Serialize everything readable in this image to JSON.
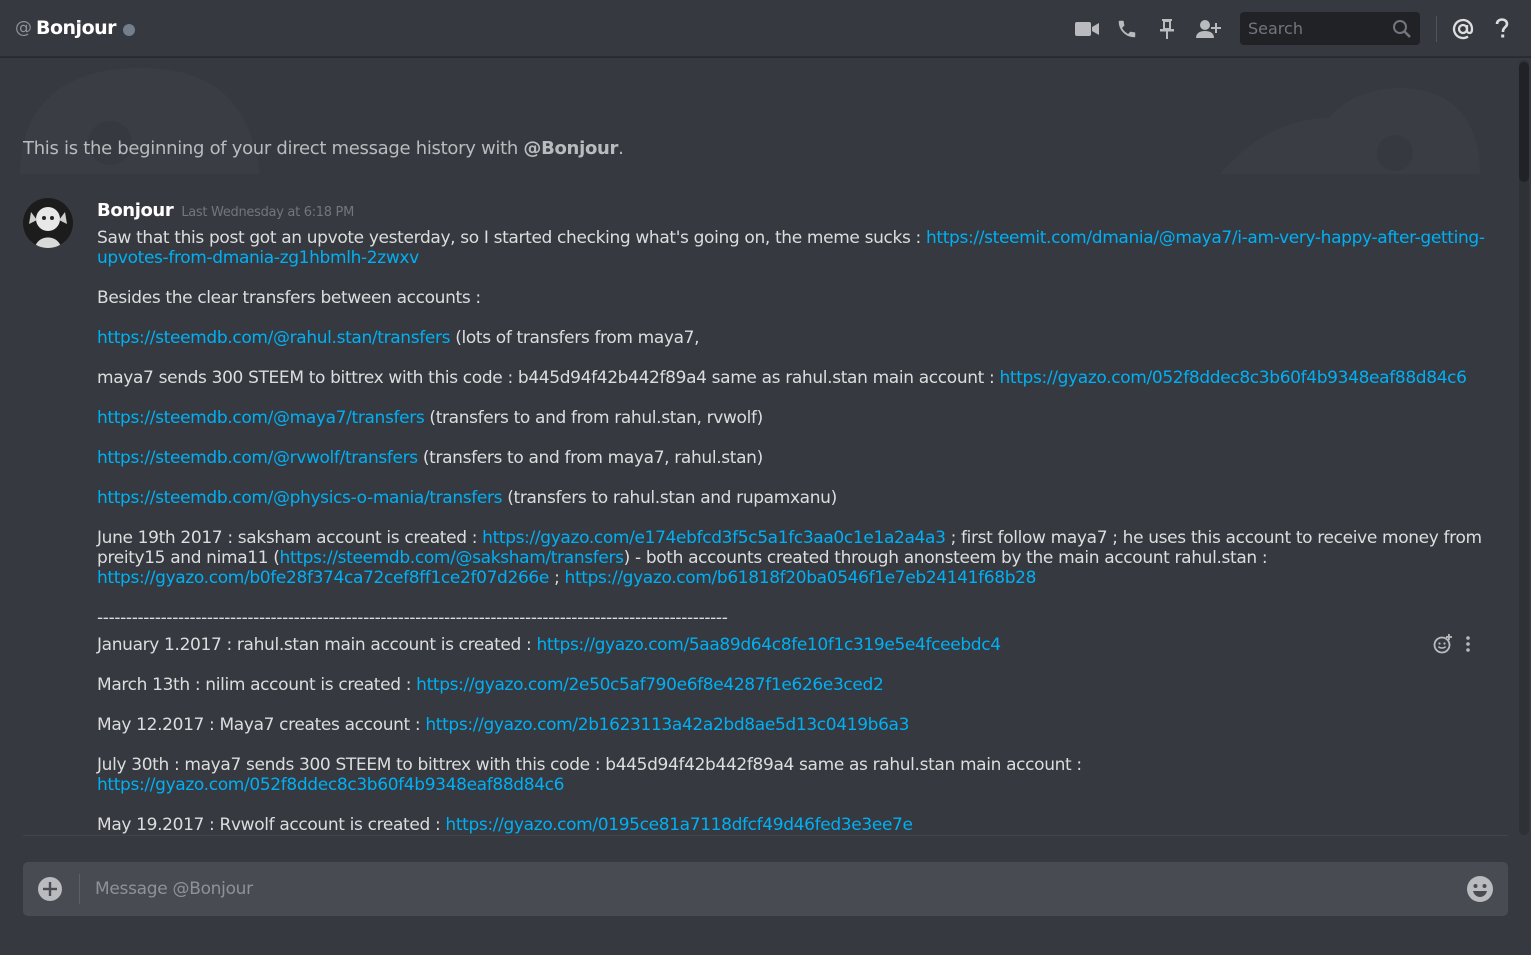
{
  "header": {
    "at_symbol": "@",
    "title": "Bonjour",
    "search_placeholder": "Search",
    "icons": [
      "video-call-icon",
      "phone-call-icon",
      "pin-icon",
      "add-friend-icon",
      "search-icon",
      "mention-icon",
      "help-icon"
    ]
  },
  "welcome": {
    "prefix": "This is the beginning of your direct message history with ",
    "handle": "@Bonjour",
    "suffix": "."
  },
  "message": {
    "author": "Bonjour",
    "timestamp": "Last Wednesday at 6:18 PM",
    "p1_text": "Saw that this post got an upvote yesterday, so I started checking what's going on, the meme sucks : ",
    "p1_link": "https://steemit.com/dmania/@maya7/i-am-very-happy-after-getting-upvotes-from-dmania-zg1hbmlh-2zwxv",
    "p2_text": "Besides the clear transfers between accounts :",
    "p3_link": "https://steemdb.com/@rahul.stan/transfers",
    "p3_text": " (lots of transfers from maya7,",
    "p4_text": "maya7 sends 300 STEEM to bittrex with this code : b445d94f42b442f89a4 same as rahul.stan main account : ",
    "p4_link": "https://gyazo.com/052f8ddec8c3b60f4b9348eaf88d84c6",
    "p5_link": "https://steemdb.com/@maya7/transfers",
    "p5_text": " (transfers to and from rahul.stan, rvwolf)",
    "p6_link": "https://steemdb.com/@rvwolf/transfers",
    "p6_text": " (transfers to and from maya7, rahul.stan)",
    "p7_link": "https://steemdb.com/@physics-o-mania/transfers",
    "p7_text": " (transfers to rahul.stan and rupamxanu)",
    "p8_a": "June 19th 2017 : saksham account is created : ",
    "p8_link1": "https://gyazo.com/e174ebfcd3f5c5a1fc3aa0c1e1a2a4a3",
    "p8_b": " ; first follow maya7 ; he uses this account to receive money from preity15 and nima11 (",
    "p8_link2": "https://steemdb.com/@saksham/transfers",
    "p8_c": ") - both accounts created through anonsteem by the main account rahul.stan : ",
    "p8_link3": "https://gyazo.com/b0fe28f374ca72cef8ff1ce2f07d266e",
    "p8_d": " ; ",
    "p8_link4": "https://gyazo.com/b61818f20ba0546f1e7eb24141f68b28",
    "separator": "-------------------------------------------------------------------------------------------------------------",
    "p9_text": "January 1.2017 : rahul.stan main account is created : ",
    "p9_link": "https://gyazo.com/5aa89d64c8fe10f1c319e5e4fceebdc4",
    "p10_text": "March 13th : nilim account is created : ",
    "p10_link": "https://gyazo.com/2e50c5af790e6f8e4287f1e626e3ced2",
    "p11_text": "May 12.2017 : Maya7 creates account : ",
    "p11_link": "https://gyazo.com/2b1623113a42a2bd8ae5d13c0419b6a3",
    "p12_text": "July 30th : maya7 sends 300 STEEM to bittrex with this code : b445d94f42b442f89a4 same as rahul.stan main account : ",
    "p12_link": "https://gyazo.com/052f8ddec8c3b60f4b9348eaf88d84c6",
    "p13_text": "May 19.2017 : Rvwolf account is created : ",
    "p13_link": "https://gyazo.com/0195ce81a7118dfcf49d46fed3e3ee7e"
  },
  "composer": {
    "placeholder": "Message @Bonjour"
  },
  "colors": {
    "background": "#36393f",
    "link": "#00b0f4",
    "author": "#ffffff",
    "muted": "#72767d"
  }
}
